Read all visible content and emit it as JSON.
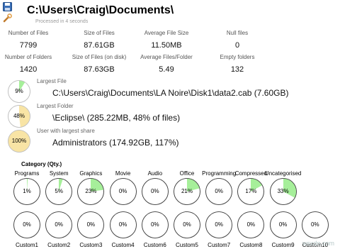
{
  "header": {
    "title": "C:\\Users\\Craig\\Documents\\",
    "subtitle": "Processed in 4 seconds",
    "icons": [
      "save-icon",
      "settings-wrench-icon"
    ]
  },
  "stats": [
    {
      "label": "Number of Files",
      "value": "7799"
    },
    {
      "label": "Size of Files",
      "value": "87.61GB"
    },
    {
      "label": "Average File Size",
      "value": "11.50MB"
    },
    {
      "label": "Null files",
      "value": "0"
    },
    {
      "label": "Number of Folders",
      "value": "1420"
    },
    {
      "label": "Size of Files (on disk)",
      "value": "87.63GB"
    },
    {
      "label": "Average Files/Folder",
      "value": "5.49"
    },
    {
      "label": "Empty folders",
      "value": "132"
    }
  ],
  "largest": [
    {
      "label": "Largest File",
      "text": "C:\\Users\\Craig\\Documents\\LA Noire\\Disk1\\data2.cab (7.60GB)",
      "percent_text": "9%",
      "percent": 9
    },
    {
      "label": "Largest Folder",
      "text": "\\Eclipse\\ (285.22MB, 48% of files)",
      "percent_text": "48%",
      "percent": 48
    },
    {
      "label": "User with largest share",
      "text": "Administrators (174.92GB, 117%)",
      "percent_text": "100%",
      "percent": 100
    }
  ],
  "categories": {
    "header": "Category (Qty.)",
    "row1": [
      {
        "name": "Programs",
        "percent_text": "1%",
        "percent": 1
      },
      {
        "name": "System",
        "percent_text": "5%",
        "percent": 5
      },
      {
        "name": "Graphics",
        "percent_text": "23%",
        "percent": 23
      },
      {
        "name": "Movie",
        "percent_text": "0%",
        "percent": 0
      },
      {
        "name": "Audio",
        "percent_text": "0%",
        "percent": 0
      },
      {
        "name": "Office",
        "percent_text": "21%",
        "percent": 21
      },
      {
        "name": "Programming",
        "percent_text": "0%",
        "percent": 0
      },
      {
        "name": "Compressed",
        "percent_text": "17%",
        "percent": 17
      },
      {
        "name": "Uncategorised",
        "percent_text": "33%",
        "percent": 33
      }
    ],
    "row2": [
      {
        "name": "Custom1",
        "percent_text": "0%",
        "percent": 0
      },
      {
        "name": "Custom2",
        "percent_text": "0%",
        "percent": 0
      },
      {
        "name": "Custom3",
        "percent_text": "0%",
        "percent": 0
      },
      {
        "name": "Custom4",
        "percent_text": "0%",
        "percent": 0
      },
      {
        "name": "Custom6",
        "percent_text": "0%",
        "percent": 0
      },
      {
        "name": "Custom5",
        "percent_text": "0%",
        "percent": 0
      },
      {
        "name": "Custom7",
        "percent_text": "0%",
        "percent": 0
      },
      {
        "name": "Custom8",
        "percent_text": "0%",
        "percent": 0
      },
      {
        "name": "Custom9",
        "percent_text": "0%",
        "percent": 0
      },
      {
        "name": "Custom10",
        "percent_text": "0%",
        "percent": 0
      }
    ]
  },
  "watermark": "wsxdn.com",
  "colors": {
    "green_fill": "#a6ef9a",
    "yellow_fill": "#f8e4a5",
    "circle_border": "#444444"
  }
}
